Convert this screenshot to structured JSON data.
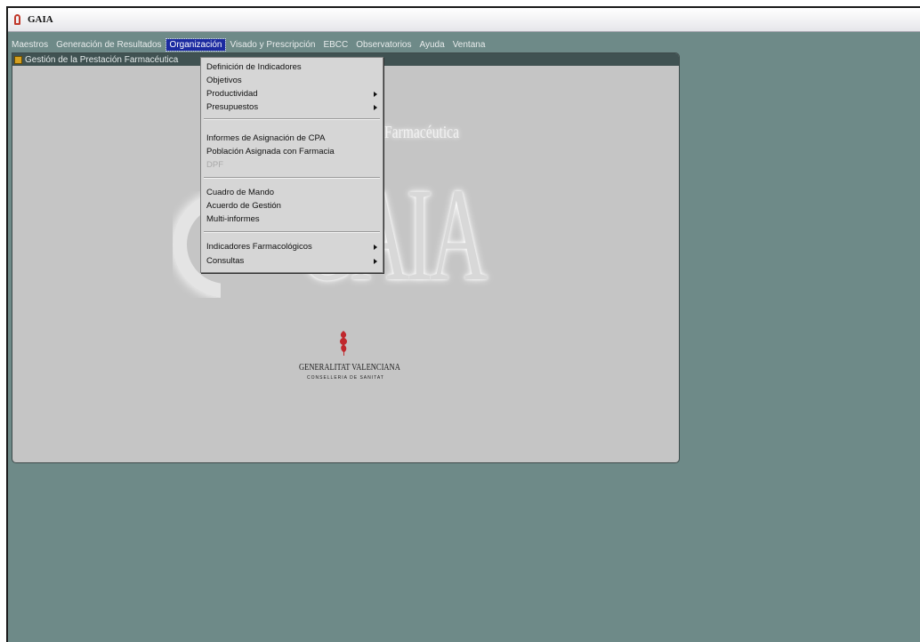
{
  "window": {
    "title": "GAIA"
  },
  "menubar": {
    "items": [
      {
        "label": "Maestros"
      },
      {
        "label": "Generación de Resultados"
      },
      {
        "label": "Organización"
      },
      {
        "label": "Visado y Prescripción"
      },
      {
        "label": "EBCC"
      },
      {
        "label": "Observatorios"
      },
      {
        "label": "Ayuda"
      },
      {
        "label": "Ventana"
      }
    ]
  },
  "mdi": {
    "caption": "Gestión de la Prestación Farmacéutica",
    "brand": {
      "subtitle": "Farmacéutica",
      "name": "GAIA"
    },
    "org": {
      "name": "GENERALITAT VALENCIANA",
      "subtitle": "CONSELLERIA DE SANITAT"
    }
  },
  "dropdown": {
    "items": [
      {
        "label": "Definición de Indicadores"
      },
      {
        "label": "Objetivos"
      },
      {
        "label": "Productividad"
      },
      {
        "label": "Presupuestos"
      },
      {
        "label": "Informes de Asignación de CPA"
      },
      {
        "label": "Población Asignada con Farmacia"
      },
      {
        "label": "DPF"
      },
      {
        "label": "Cuadro de Mando"
      },
      {
        "label": "Acuerdo de Gestión"
      },
      {
        "label": "Multi-informes"
      },
      {
        "label": "Indicadores Farmacológicos"
      },
      {
        "label": "Consultas"
      }
    ]
  },
  "colors": {
    "desktop": "#6e8a88",
    "menu_highlight": "#1b2aa0",
    "mdi_background": "#c5c5c5"
  }
}
